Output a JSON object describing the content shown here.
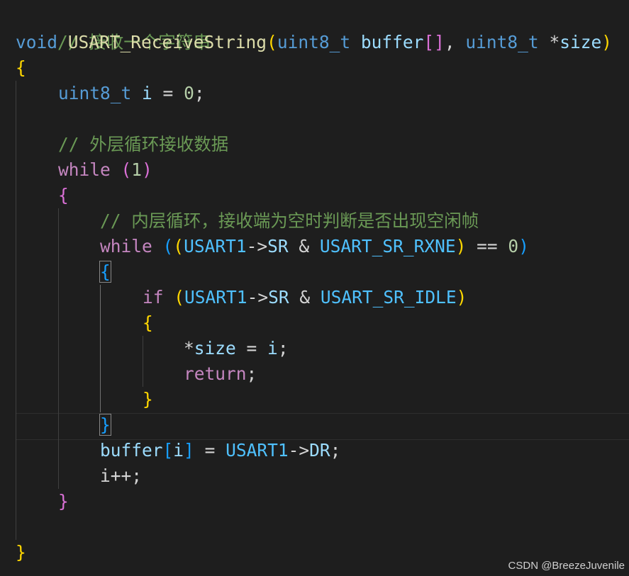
{
  "code": {
    "l01_comment": "// 接收一个字符串",
    "l02": {
      "kw_void": "void",
      "fn_name": "USART_ReceiveString",
      "paren_open": "(",
      "type1": "uint8_t",
      "param1": "buffer",
      "bracket_open": "[",
      "bracket_close": "]",
      "comma": ", ",
      "type2": "uint8_t",
      "star": "*",
      "param2": "size",
      "paren_close": ")"
    },
    "l03_brace": "{",
    "l04": {
      "type": "uint8_t",
      "var": "i",
      "assign": " = ",
      "num": "0",
      "semi": ";"
    },
    "l06_comment": "// 外层循环接收数据",
    "l07": {
      "kw": "while",
      "open": "(",
      "num": "1",
      "close": ")"
    },
    "l08_brace": "{",
    "l09_comment": "// 内层循环，接收端为空时判断是否出现空闲帧",
    "l10": {
      "kw": "while",
      "open1": "(",
      "open2": "(",
      "reg": "USART1",
      "arrow": "->",
      "field": "SR",
      "amp": " & ",
      "flag": "USART_SR_RXNE",
      "close2": ")",
      "eq": " == ",
      "num": "0",
      "close1": ")"
    },
    "l11_brace": "{",
    "l12": {
      "kw": "if",
      "open": "(",
      "reg": "USART1",
      "arrow": "->",
      "field": "SR",
      "amp": " & ",
      "flag": "USART_SR_IDLE",
      "close": ")"
    },
    "l13_brace": "{",
    "l14": {
      "star": "*",
      "var": "size",
      "assign": " = ",
      "val": "i",
      "semi": ";"
    },
    "l15": {
      "kw": "return",
      "semi": ";"
    },
    "l16_brace": "}",
    "l17_brace": "}",
    "l18": {
      "var": "buffer",
      "open": "[",
      "idx": "i",
      "close": "]",
      "assign": " = ",
      "reg": "USART1",
      "arrow": "->",
      "field": "DR",
      "semi": ";"
    },
    "l19": {
      "var": "i",
      "op": "++",
      "semi": ";"
    },
    "l20_brace": "}",
    "l22_brace": "}"
  },
  "watermark": "CSDN @BreezeJuvenile",
  "colors": {
    "background": "#1e1e1e",
    "keyword_type": "#569cd6",
    "keyword_control": "#c586c0",
    "function": "#dcdcaa",
    "variable": "#9cdcfe",
    "constant": "#4fc1ff",
    "number": "#b5cea8",
    "comment": "#6a9955",
    "bracket_level1": "#ffd700",
    "bracket_level2": "#da70d6",
    "bracket_level3": "#179fff"
  }
}
